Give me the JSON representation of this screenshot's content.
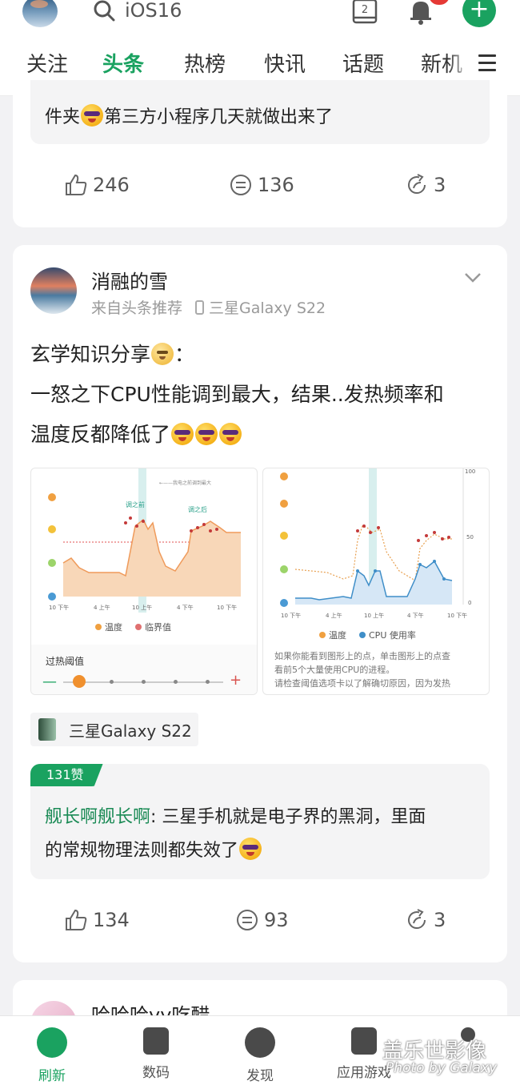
{
  "header": {
    "search_text": "iOS16",
    "clipboard_badge": "2",
    "tabs": [
      {
        "label": "关注"
      },
      {
        "label": "头条"
      },
      {
        "label": "热榜"
      },
      {
        "label": "快讯"
      },
      {
        "label": "话题"
      },
      {
        "label": "新机"
      }
    ],
    "active_tab": "头条"
  },
  "card_prev": {
    "quote_text": "件夹",
    "quote_text_tail": "第三方小程序几天就做出来了",
    "likes": "246",
    "comments": "136",
    "shares": "3"
  },
  "post": {
    "username": "消融的雪",
    "source": "来自头条推荐",
    "device": "三星Galaxy S22",
    "text_line1": "玄学知识分享",
    "text_line1_tail": "：",
    "text_line2": "一怒之下CPU性能调到最大，结果..发热频率和",
    "text_line3": "温度反都降低了",
    "image_left": {
      "annotation_top": "←——我电之前调到最大",
      "label_before": "调之前",
      "label_after": "调之后",
      "x_ticks": [
        "10 下午",
        "4 上午",
        "10 上午",
        "4 下午",
        "10 下午"
      ],
      "legend_temp": "温度",
      "legend_limit": "临界值",
      "threshold_label": "过热阈值",
      "minus": "—",
      "plus": "+"
    },
    "image_right": {
      "y_ticks": [
        "100",
        "50",
        "0"
      ],
      "x_ticks": [
        "10 下午",
        "4 上午",
        "10 上午",
        "4 下午",
        "10 下午"
      ],
      "legend_temp": "温度",
      "legend_cpu": "CPU 使用率",
      "desc_line1": "如果你能看到图形上的点，单击图形上的点查",
      "desc_line2": "看前5个大量使用CPU的进程。",
      "desc_line3": "请检查阈值选项卡以了解确切原因，因为发热"
    },
    "device_chip": "三星Galaxy S22",
    "hot_comment": {
      "likes_tag": "131赞",
      "author": "舰长啊舰长啊",
      "text_line1": ": 三星手机就是电子界的黑洞，里面",
      "text_line2": "的常规物理法则都失效了"
    },
    "likes": "134",
    "comments": "93",
    "shares": "3"
  },
  "next_post": {
    "username": "哈哈哈yy吃醋"
  },
  "bottom_nav": [
    {
      "label": "刷新"
    },
    {
      "label": "数码"
    },
    {
      "label": "发现"
    },
    {
      "label": "应用游戏"
    },
    {
      "label": ""
    }
  ],
  "watermark": {
    "line1": "盖乐世影像",
    "line2": "Photo by Galaxy"
  },
  "colors": {
    "accent": "#1aa260",
    "badge": "#e53935"
  }
}
